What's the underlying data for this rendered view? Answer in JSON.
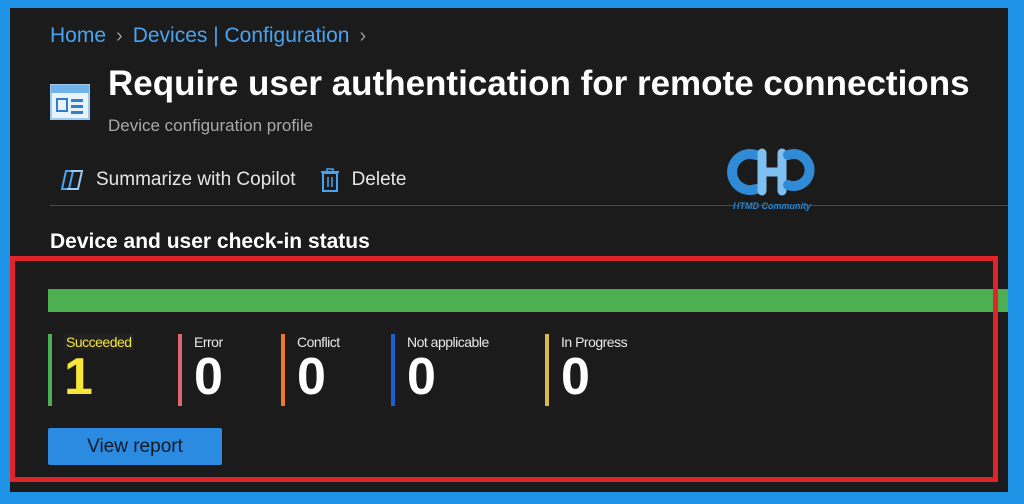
{
  "breadcrumb": {
    "items": [
      "Home",
      "Devices | Configuration"
    ],
    "separator": ">"
  },
  "header": {
    "title": "Require user authentication for remote connections",
    "subtitle": "Device configuration profile",
    "icon": "profile-icon"
  },
  "toolbar": {
    "copilot_label": "Summarize with Copilot",
    "copilot_icon": "copilot-icon",
    "delete_label": "Delete",
    "delete_icon": "trash-icon"
  },
  "watermark": {
    "text": "HTMD Community"
  },
  "checkin": {
    "section_title": "Device and user check-in status",
    "progress_succeeded_fraction": 1.0,
    "stats": [
      {
        "label": "Succeeded",
        "value": "1",
        "color": "#4caf50"
      },
      {
        "label": "Error",
        "value": "0",
        "color": "#d9686e"
      },
      {
        "label": "Conflict",
        "value": "0",
        "color": "#f0782a"
      },
      {
        "label": "Not applicable",
        "value": "0",
        "color": "#1e5fd6"
      },
      {
        "label": "In Progress",
        "value": "0",
        "color": "#d8bc4a"
      }
    ],
    "view_report_label": "View report"
  },
  "colors": {
    "accent": "#4aa3ee",
    "highlight_border": "#e0242b",
    "progress_fill": "#4caf50"
  }
}
